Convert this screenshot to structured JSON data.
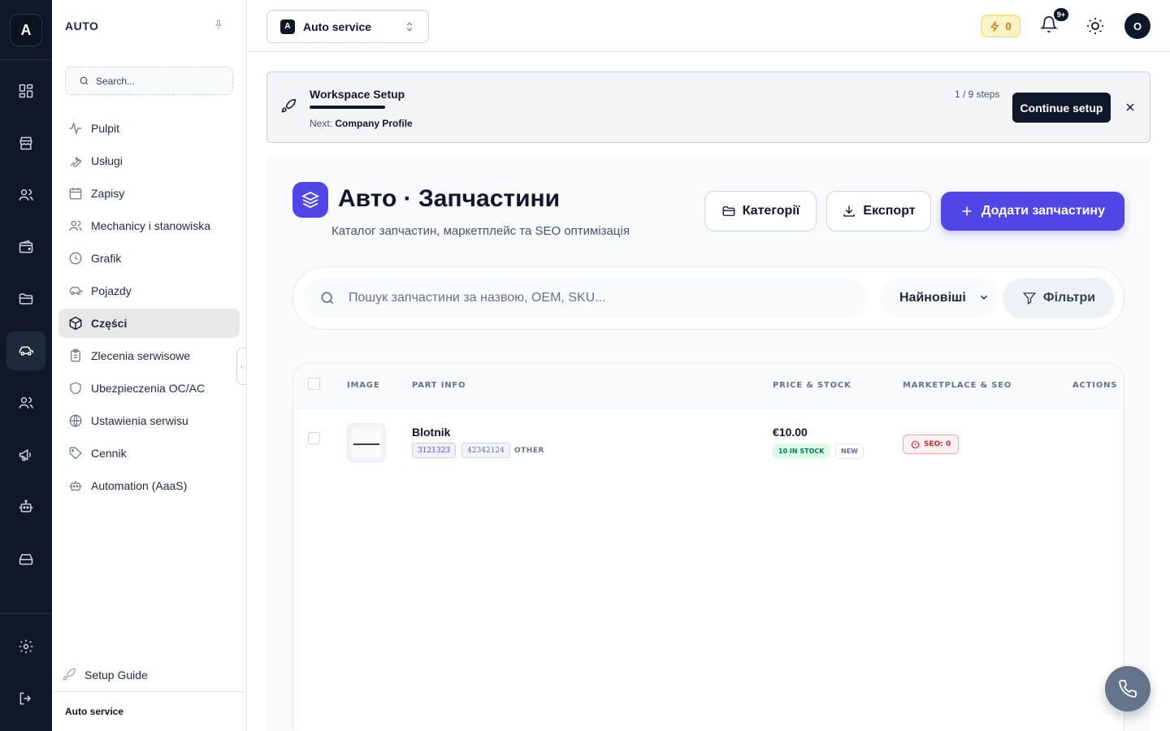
{
  "rail": {
    "logo": "A",
    "icons": [
      "dashboard-icon",
      "store-icon",
      "users-icon",
      "wallet-icon",
      "folder-icon",
      "car-icon",
      "team-icon",
      "megaphone-icon",
      "bot-icon",
      "drive-icon",
      "gear-icon",
      "logout-icon"
    ],
    "active": "car-icon"
  },
  "sidebar": {
    "title": "AUTO",
    "search_placeholder": "Search...",
    "items": [
      {
        "label": "Pulpit",
        "icon": "activity-icon"
      },
      {
        "label": "Usługi",
        "icon": "wrench-icon"
      },
      {
        "label": "Zapisy",
        "icon": "calendar-icon"
      },
      {
        "label": "Mechanicy i stanowiska",
        "icon": "users-icon"
      },
      {
        "label": "Grafik",
        "icon": "clock-icon"
      },
      {
        "label": "Pojazdy",
        "icon": "car-icon"
      },
      {
        "label": "Części",
        "icon": "package-icon",
        "active": true
      },
      {
        "label": "Zlecenia serwisowe",
        "icon": "clipboard-icon"
      },
      {
        "label": "Ubezpieczenia OC/AC",
        "icon": "shield-icon"
      },
      {
        "label": "Ustawienia serwisu",
        "icon": "globe-icon"
      },
      {
        "label": "Cennik",
        "icon": "tag-icon"
      },
      {
        "label": "Automation (AaaS)",
        "icon": "bot-icon"
      }
    ],
    "setup_guide": "Setup Guide",
    "footer": "Auto service"
  },
  "header": {
    "workspace_badge": "A",
    "workspace": "Auto service",
    "credits": "0",
    "notifications_badge": "9+",
    "avatar": "O"
  },
  "banner": {
    "title": "Workspace Setup",
    "next_prefix": "Next:",
    "next_step": "Company Profile",
    "steps": "1 / 9 steps",
    "progress": 0.11,
    "button": "Continue setup"
  },
  "page": {
    "title": "Авто · Запчастини",
    "subtitle": "Каталог запчастин, маркетплейс та SEO оптимізація",
    "categories_button": "Категорії",
    "export_button": "Експорт",
    "add_button": "Додати запчастину",
    "search_placeholder": "Пошук запчастини за назвою, OEM, SKU...",
    "sort_value": "Найновіші",
    "filters_button": "Фільтри"
  },
  "table": {
    "columns": [
      "IMAGE",
      "PART INFO",
      "PRICE & STOCK",
      "MARKETPLACE & SEO",
      "ACTIONS"
    ],
    "rows": [
      {
        "name": "Blotnik",
        "sku": "3121323",
        "oem": "42342124",
        "category": "OTHER",
        "price": "€10.00",
        "stock": "10 IN STOCK",
        "condition": "NEW",
        "seo": "SEO: 0"
      }
    ]
  }
}
